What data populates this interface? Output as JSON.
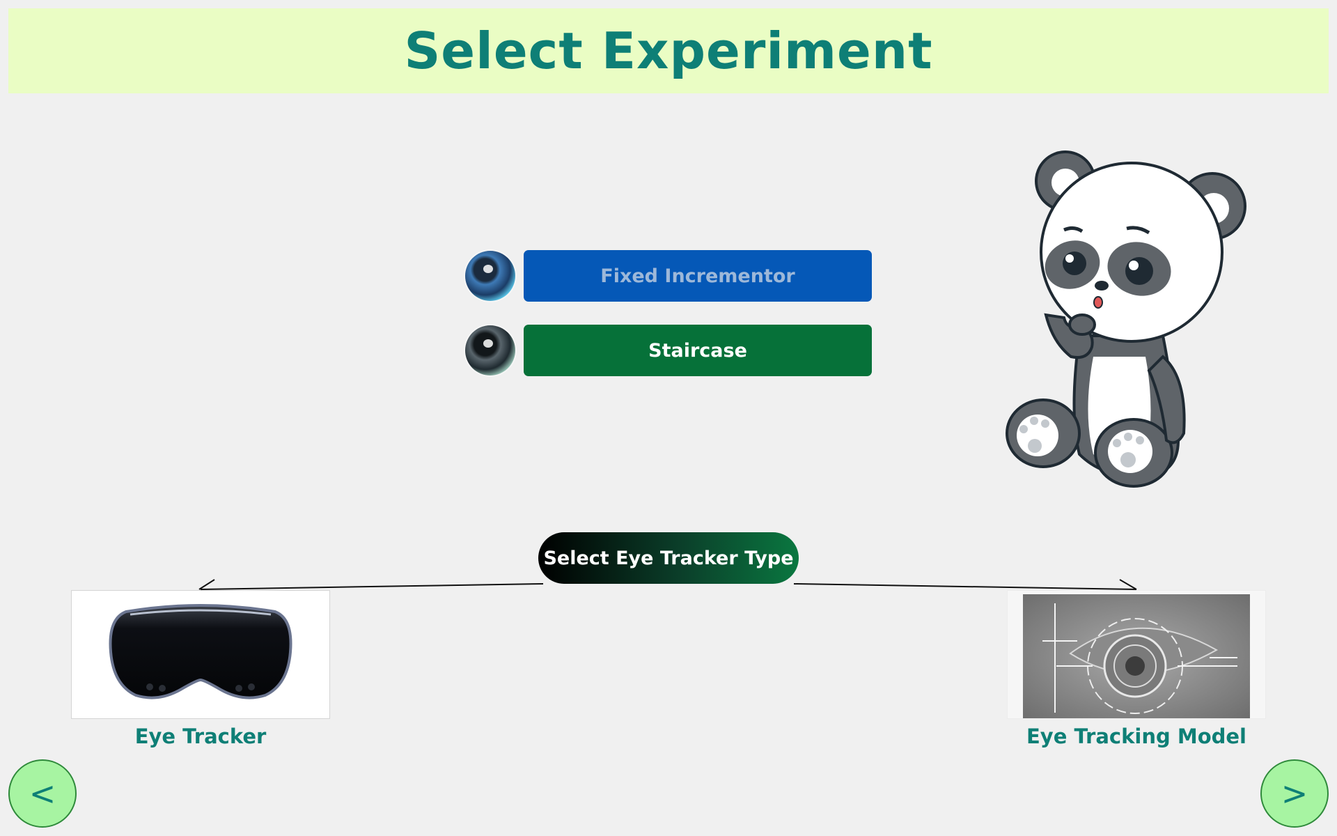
{
  "header": {
    "title": "Select Experiment"
  },
  "experiments": [
    {
      "label": "Fixed Incrementor",
      "icon": "blue-eye-icon"
    },
    {
      "label": "Staircase",
      "icon": "teal-eye-icon"
    }
  ],
  "tracker_type": {
    "label": "Select Eye Tracker Type"
  },
  "options": [
    {
      "label": "Eye Tracker",
      "icon": "vr-headset-image"
    },
    {
      "label": "Eye Tracking Model",
      "icon": "eye-scan-image"
    }
  ],
  "nav": {
    "prev_label": "<",
    "next_label": ">"
  },
  "colors": {
    "header_bg": "#eafdc4",
    "title": "#0e7f76",
    "fixed_button": "#0558b7",
    "staircase_button": "#067139",
    "nav_button": "#a7f4a2"
  }
}
